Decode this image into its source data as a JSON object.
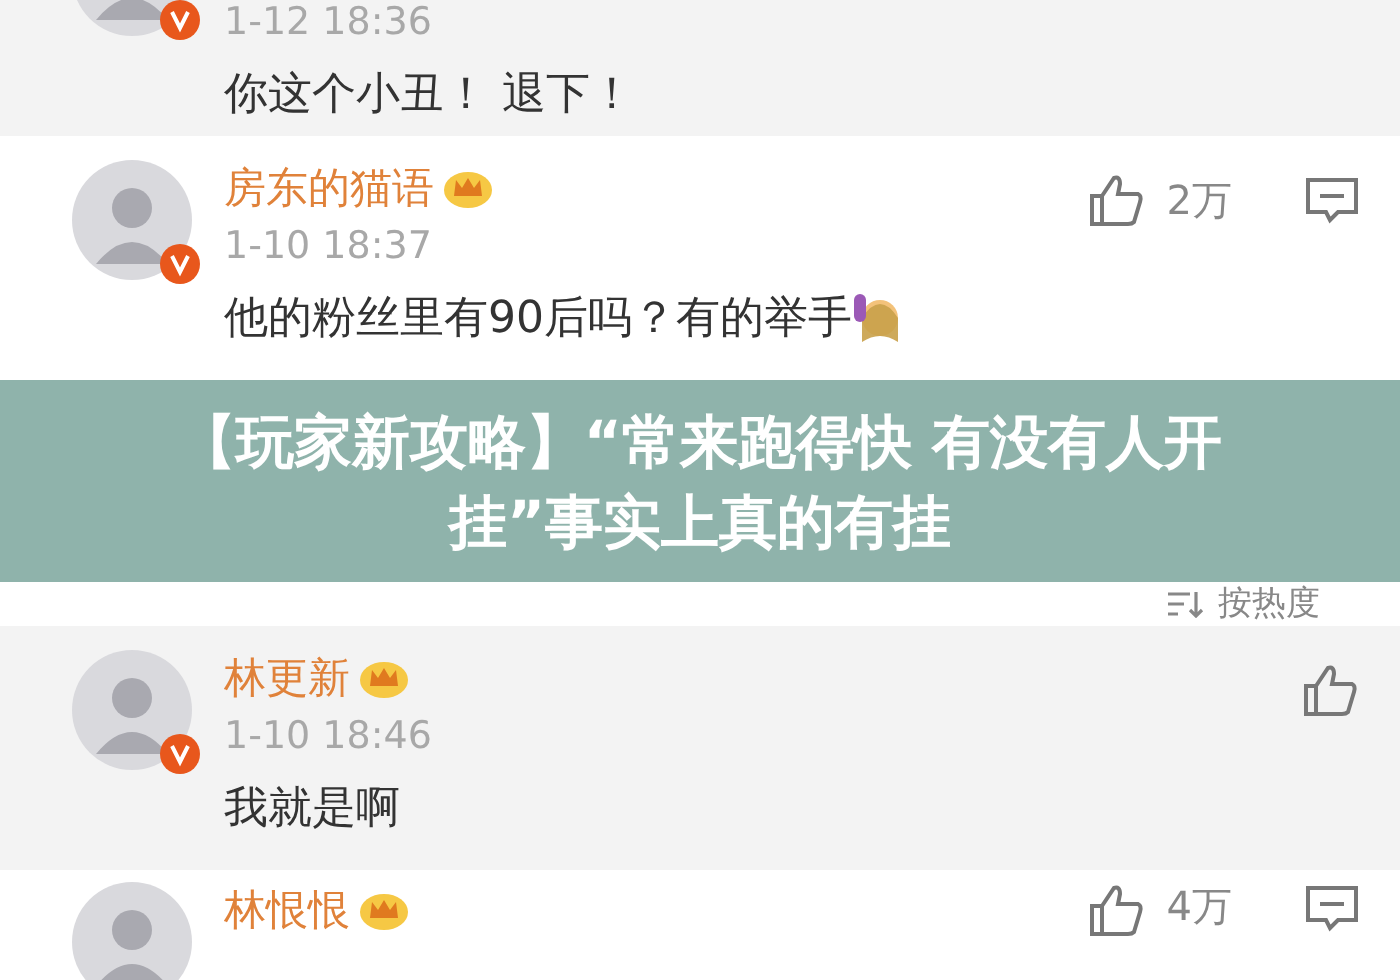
{
  "comments": [
    {
      "kind": "partial",
      "time": "1-12 18:36",
      "text": "你这个小丑！ 退下！",
      "shaded": true
    },
    {
      "kind": "full",
      "name": "房东的猫语",
      "time": "1-10 18:37",
      "text": "他的粉丝里有90后吗？有的举手",
      "emoji": true,
      "like_count": "2万",
      "reply": true,
      "shaded": false
    },
    {
      "kind": "sort",
      "label": "按热度"
    },
    {
      "kind": "full",
      "name": "林更新",
      "time": "1-10 18:46",
      "text": "我就是啊",
      "emoji": false,
      "reply": false,
      "shaded": true
    },
    {
      "kind": "cut",
      "name": "林恨恨",
      "like_count": "4万",
      "reply": true,
      "shaded": false
    }
  ],
  "banner": {
    "title": "【玩家新攻略】“常来跑得快 有没有人开挂”事实上真的有挂"
  }
}
